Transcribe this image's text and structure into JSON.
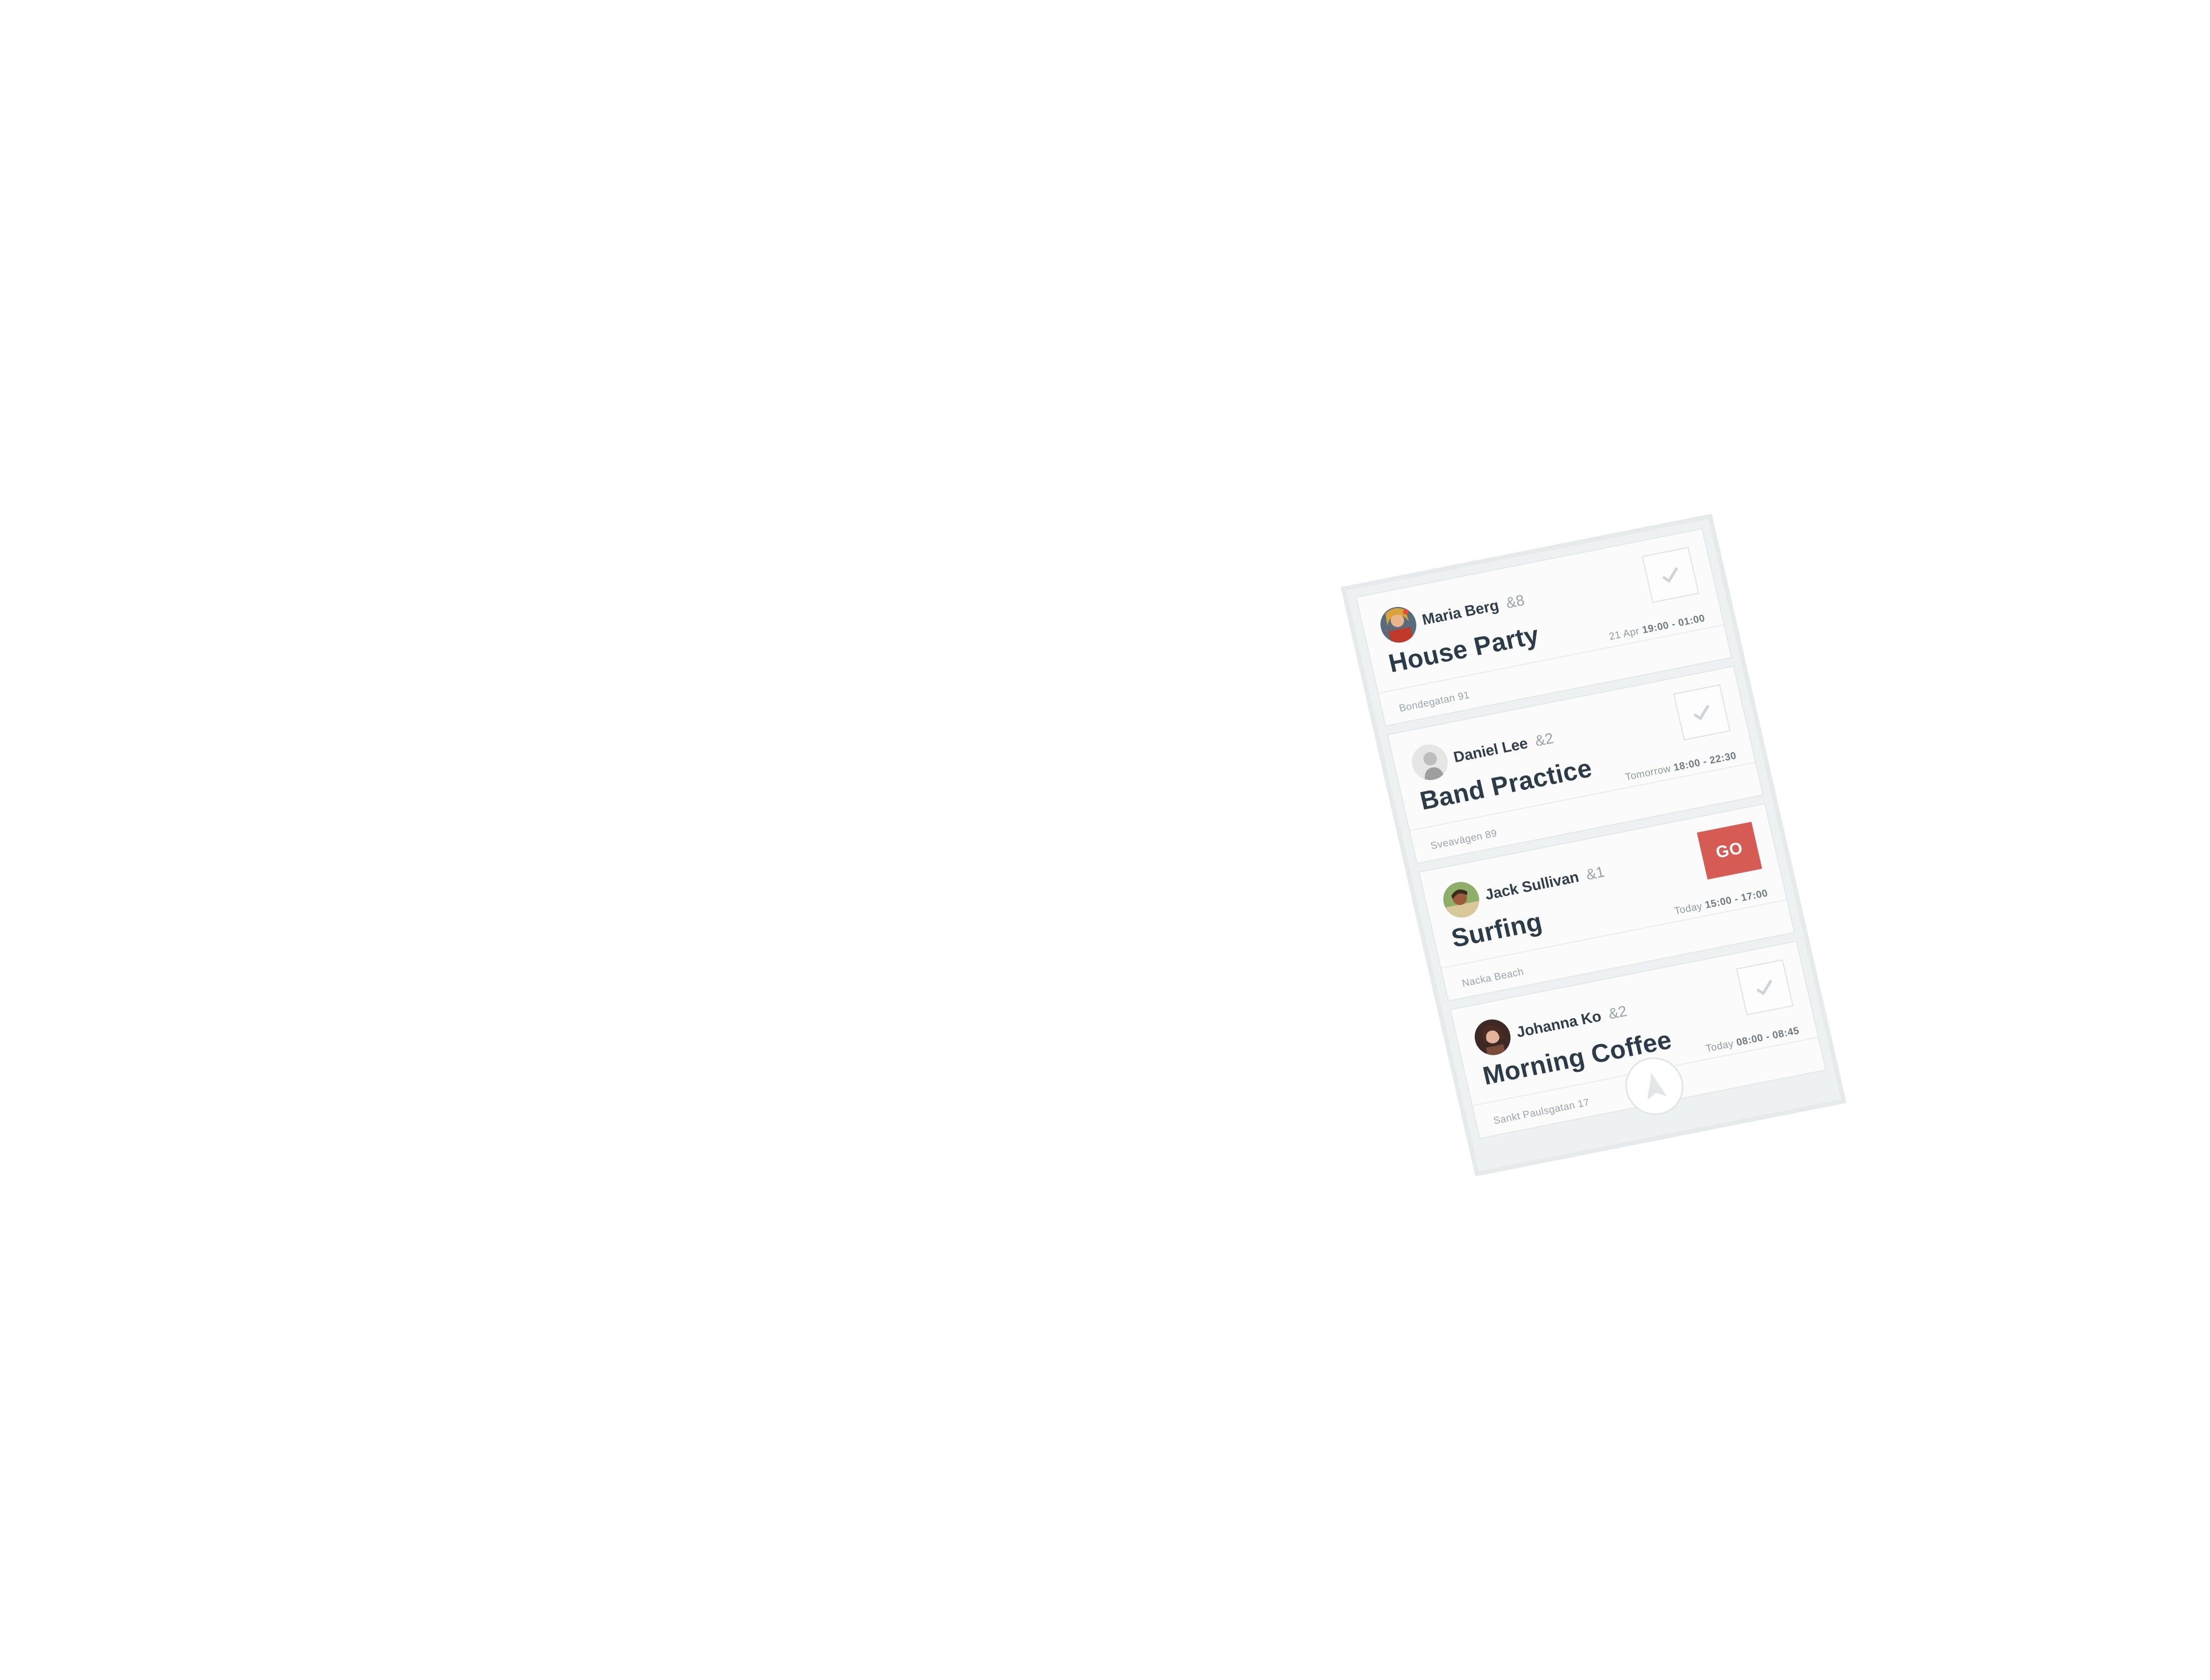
{
  "events": [
    {
      "host": "Maria Berg",
      "extra": "&8",
      "title": "House Party",
      "address": "Bondegatan 91",
      "time_prefix": "21 Apr",
      "time_range": "19:00 - 01:00",
      "action": "check",
      "avatar_icon": "avatar-maria"
    },
    {
      "host": "Daniel Lee",
      "extra": "&2",
      "title": "Band Practice",
      "address": "Sveavägen 89",
      "time_prefix": "Tomorrow",
      "time_range": "18:00 - 22:30",
      "action": "check",
      "avatar_icon": "avatar-daniel"
    },
    {
      "host": "Jack Sullivan",
      "extra": "&1",
      "title": "Surfing",
      "address": "Nacka Beach",
      "time_prefix": "Today",
      "time_range": "15:00 - 17:00",
      "action": "go",
      "go_label": "GO",
      "avatar_icon": "avatar-jack"
    },
    {
      "host": "Johanna Ko",
      "extra": "&2",
      "title": "Morning Coffee",
      "address": "Sankt Paulsgatan 17",
      "time_prefix": "Today",
      "time_range": "08:00 - 08:45",
      "action": "check",
      "avatar_icon": "avatar-johanna"
    }
  ],
  "fab": {
    "icon": "navigate-arrow-icon"
  },
  "colors": {
    "go": "#d65b55",
    "title": "#2c3b48",
    "muted": "#9aa3a8",
    "background": "#eef1f1"
  }
}
